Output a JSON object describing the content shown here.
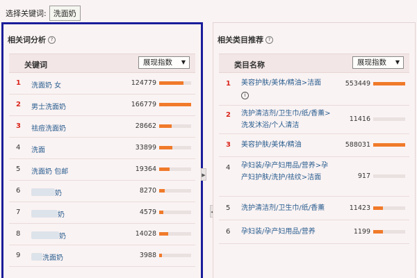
{
  "topbar": {
    "label": "选择关键词:",
    "keyword": "洗面奶"
  },
  "left": {
    "title": "相关词分析",
    "header_label": "关键词",
    "select_value": "展现指数",
    "rows": [
      {
        "rank": "1",
        "keyword": "洗面奶 女",
        "value": "124779",
        "fill": 0.75
      },
      {
        "rank": "2",
        "keyword": "男士洗面奶",
        "value": "166779",
        "fill": 1.0
      },
      {
        "rank": "3",
        "keyword": "祛痘洗面奶",
        "value": "28662",
        "fill": 0.4
      },
      {
        "rank": "4",
        "keyword": "洗面",
        "value": "33899",
        "fill": 0.42
      },
      {
        "rank": "5",
        "keyword": "洗面奶 包邮",
        "value": "19364",
        "fill": 0.32
      },
      {
        "rank": "6",
        "keyword": "奶",
        "value": "8270",
        "fill": 0.18
      },
      {
        "rank": "7",
        "keyword": "奶",
        "value": "4579",
        "fill": 0.12
      },
      {
        "rank": "8",
        "keyword": "奶",
        "value": "14028",
        "fill": 0.28
      },
      {
        "rank": "9",
        "keyword": "洗面奶",
        "value": "3988",
        "fill": 0.08
      }
    ]
  },
  "right": {
    "title": "相关类目推荐",
    "header_label": "类目名称",
    "select_value": "展现指数",
    "rows": [
      {
        "rank": "1",
        "category": "美容护肤/美体/精油>洁面",
        "value": "553449",
        "fill": 1.0
      },
      {
        "rank": "2",
        "category": "洗护清洁剂/卫生巾/纸/香薰>洗发沐浴/个人清洁",
        "value": "11416",
        "fill": 0.0
      },
      {
        "rank": "3",
        "category": "美容护肤/美体/精油",
        "value": "588031",
        "fill": 1.0
      },
      {
        "rank": "4",
        "category": "孕妇装/孕产妇用品/营养>孕产妇护肤/洗护/祛纹>洁面",
        "value": "917",
        "fill": 0.0
      },
      {
        "rank": "5",
        "category": "洗护清洁剂/卫生巾/纸/香薰",
        "value": "11423",
        "fill": 0.3
      },
      {
        "rank": "6",
        "category": "孕妇装/孕产妇用品/营养",
        "value": "1199",
        "fill": 0.3
      }
    ]
  }
}
